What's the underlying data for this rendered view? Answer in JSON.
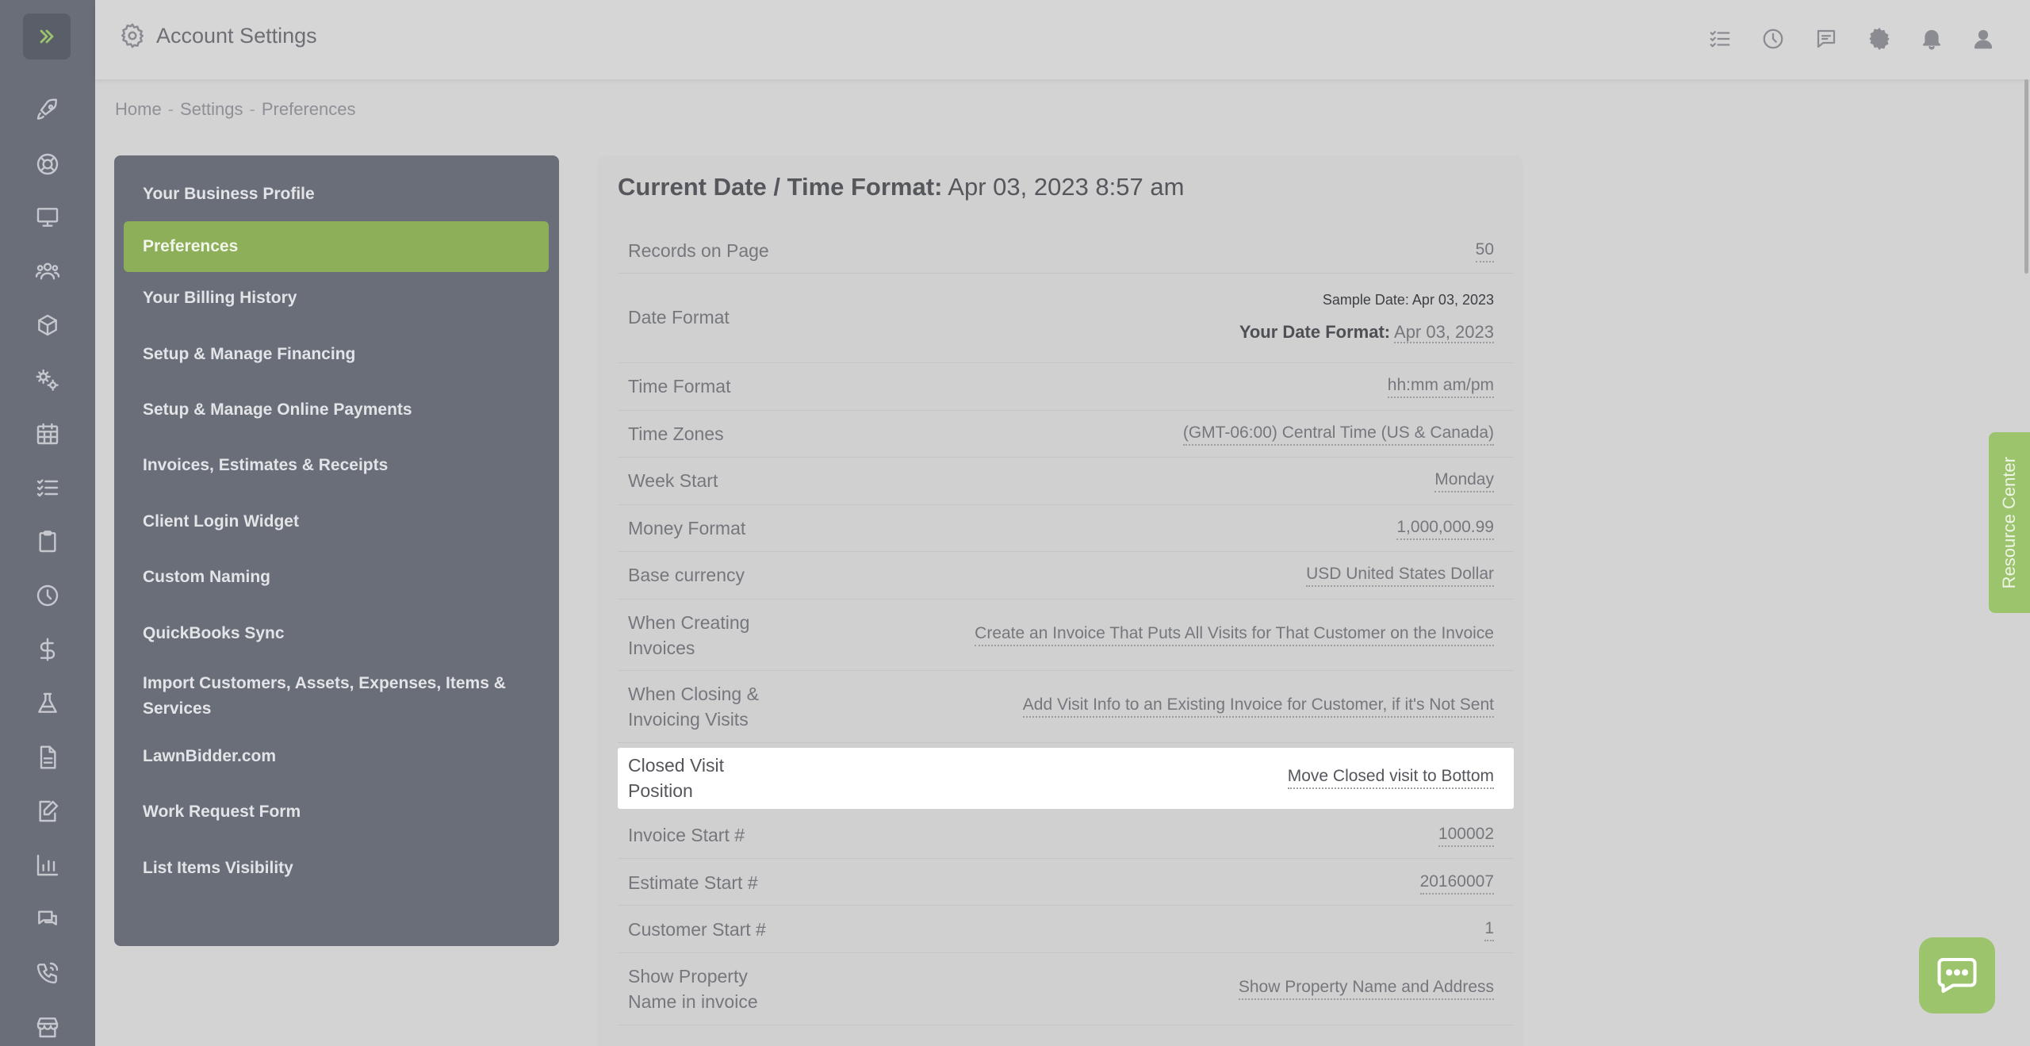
{
  "header": {
    "title": "Account Settings",
    "icons": [
      "checklist-icon",
      "clock-icon",
      "message-icon",
      "gear-icon",
      "bell-icon",
      "user-icon"
    ]
  },
  "rail": {
    "icons": [
      "rocket-icon",
      "lifebuoy-icon",
      "monitor-icon",
      "users-icon",
      "box-icon",
      "gears-icon",
      "calendar-icon",
      "checklist-icon",
      "clipboard-icon",
      "clock-icon",
      "dollar-icon",
      "flask-icon",
      "document-icon",
      "edit-document-icon",
      "bar-chart-icon",
      "chat-icon",
      "phone-icon",
      "store-icon"
    ]
  },
  "breadcrumb": {
    "home": "Home",
    "settings": "Settings",
    "current": "Preferences",
    "separator": "-"
  },
  "menu": {
    "items": [
      {
        "label": "Your Business Profile",
        "active": false
      },
      {
        "label": "Preferences",
        "active": true
      },
      {
        "label": "Your Billing History",
        "active": false
      },
      {
        "label": "Setup & Manage Financing",
        "active": false
      },
      {
        "label": "Setup & Manage Online Payments",
        "active": false
      },
      {
        "label": "Invoices, Estimates & Receipts",
        "active": false
      },
      {
        "label": "Client Login Widget",
        "active": false
      },
      {
        "label": "Custom Naming",
        "active": false
      },
      {
        "label": "QuickBooks Sync",
        "active": false
      },
      {
        "label": "Import Customers, Assets, Expenses, Items & Services",
        "active": false
      },
      {
        "label": "LawnBidder.com",
        "active": false
      },
      {
        "label": "Work Request Form",
        "active": false
      },
      {
        "label": "List Items Visibility",
        "active": false
      }
    ]
  },
  "panel": {
    "title_label": "Current Date / Time Format:",
    "title_value": "Apr 03, 2023 8:57 am",
    "rows": [
      {
        "label": "Records on Page",
        "value": "50"
      },
      {
        "label": "Date Format",
        "sample": "Sample Date: Apr 03, 2023",
        "your_label": "Your Date Format:",
        "value": "Apr 03, 2023"
      },
      {
        "label": "Time Format",
        "value": "hh:mm am/pm"
      },
      {
        "label": "Time Zones",
        "value": "(GMT-06:00) Central Time (US & Canada)"
      },
      {
        "label": "Week Start",
        "value": "Monday"
      },
      {
        "label": "Money Format",
        "value": "1,000,000.99"
      },
      {
        "label": "Base currency",
        "value": "USD United States Dollar"
      },
      {
        "label": "When Creating Invoices",
        "value": "Create an Invoice That Puts All Visits for That Customer on the Invoice"
      },
      {
        "label": "When Closing & Invoicing Visits",
        "value": "Add Visit Info to an Existing Invoice for Customer, if it's Not Sent"
      },
      {
        "label": "Closed Visit Position",
        "value": "Move Closed visit to Bottom"
      },
      {
        "label": "Invoice Start #",
        "value": "100002"
      },
      {
        "label": "Estimate Start #",
        "value": "20160007"
      },
      {
        "label": "Customer Start #",
        "value": "1"
      },
      {
        "label": "Show Property Name in invoice",
        "value": "Show Property Name and Address"
      }
    ]
  },
  "resource_center": "Resource Center",
  "colors": {
    "accent": "#8daf5a",
    "sidebar": "#6a6e79",
    "highlight": "#ffffff"
  }
}
